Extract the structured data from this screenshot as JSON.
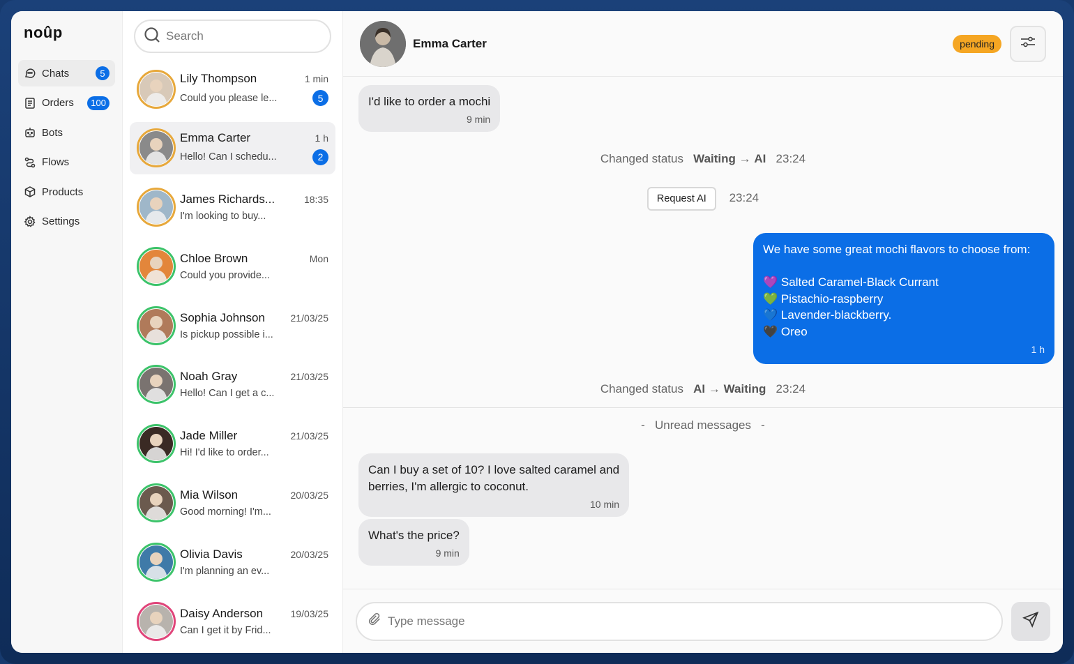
{
  "app": {
    "logo": "noûp"
  },
  "sidebar": {
    "items": [
      {
        "label": "Chats",
        "badge": "5",
        "icon": "chat-icon"
      },
      {
        "label": "Orders",
        "badge": "100",
        "icon": "orders-icon"
      },
      {
        "label": "Bots",
        "badge": "",
        "icon": "bot-icon"
      },
      {
        "label": "Flows",
        "badge": "",
        "icon": "flow-icon"
      },
      {
        "label": "Products",
        "badge": "",
        "icon": "box-icon"
      },
      {
        "label": "Settings",
        "badge": "",
        "icon": "gear-icon"
      }
    ]
  },
  "search": {
    "placeholder": "Search"
  },
  "chats": [
    {
      "name": "Lily Thompson",
      "time": "1 min",
      "preview": "Could you please le...",
      "unread": "5",
      "ring": "#e7a83b",
      "tone": "#d8c9b8"
    },
    {
      "name": "Emma Carter",
      "time": "1 h",
      "preview": "Hello! Can I schedu...",
      "unread": "2",
      "ring": "#e7a83b",
      "tone": "#8a8a8a"
    },
    {
      "name": "James Richards...",
      "time": "18:35",
      "preview": "I'm looking to buy...",
      "unread": "",
      "ring": "#e7a83b",
      "tone": "#9fb7c9"
    },
    {
      "name": "Chloe Brown",
      "time": "Mon",
      "preview": "Could you provide...",
      "unread": "",
      "ring": "#3cc36a",
      "tone": "#e3863b"
    },
    {
      "name": "Sophia Johnson",
      "time": "21/03/25",
      "preview": "Is pickup possible i...",
      "unread": "",
      "ring": "#3cc36a",
      "tone": "#b07a5a"
    },
    {
      "name": "Noah Gray",
      "time": "21/03/25",
      "preview": "Hello! Can I get a c...",
      "unread": "",
      "ring": "#3cc36a",
      "tone": "#7a7370"
    },
    {
      "name": "Jade Miller",
      "time": "21/03/25",
      "preview": "Hi! I'd like to order...",
      "unread": "",
      "ring": "#3cc36a",
      "tone": "#3a2a24"
    },
    {
      "name": "Mia Wilson",
      "time": "20/03/25",
      "preview": "Good morning! I'm...",
      "unread": "",
      "ring": "#3cc36a",
      "tone": "#6b5a4e"
    },
    {
      "name": "Olivia Davis",
      "time": "20/03/25",
      "preview": "I'm planning an ev...",
      "unread": "",
      "ring": "#3cc36a",
      "tone": "#3f7aa8"
    },
    {
      "name": "Daisy Anderson",
      "time": "19/03/25",
      "preview": "Can I get it by Frid...",
      "unread": "",
      "ring": "#e0457a",
      "tone": "#b8b3ad"
    }
  ],
  "conversation": {
    "contact": "Emma Carter",
    "status": "pending",
    "messages": {
      "m1": {
        "text": "I'd like to order a mochi",
        "time": "9 min"
      },
      "sys1": {
        "label": "Changed status",
        "from": "Waiting",
        "arrow": "→",
        "to": "AI",
        "time": "23:24"
      },
      "req": {
        "label": "Request AI",
        "time": "23:24"
      },
      "out": {
        "line1": "We have some great mochi flavors to choose from:",
        "items": [
          {
            "emoji": "💜",
            "text": "Salted Caramel-Black Currant"
          },
          {
            "emoji": "💚",
            "text": "Pistachio-raspberry"
          },
          {
            "emoji": "💙",
            "text": "Lavender-blackberry."
          },
          {
            "emoji": "🖤",
            "text": "Oreo"
          }
        ],
        "time": "1 h"
      },
      "sys2": {
        "label": "Changed status",
        "from": "AI",
        "arrow": "→",
        "to": "Waiting",
        "time": "23:24"
      },
      "unread_label": "Unread messages",
      "m2": {
        "line1": "Can I buy a set of 10? I love salted caramel and",
        "line2": "berries, I'm allergic to coconut.",
        "time": "10 min"
      },
      "m3": {
        "text": "What's the price?",
        "time": "9 min"
      }
    },
    "input_placeholder": "Type message"
  },
  "colors": {
    "accent": "#0b6ee6",
    "pending": "#f5a623"
  }
}
